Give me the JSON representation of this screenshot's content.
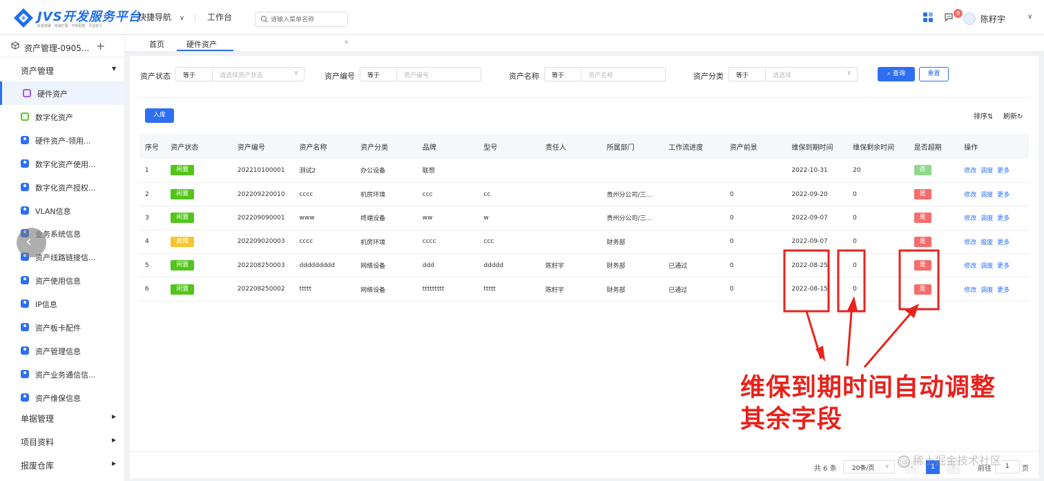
{
  "header": {
    "brand": "JVS开发服务平台",
    "slogan": "私有部署 · 快速扩展 · 可视配置 · 灵活定义",
    "quick_nav": "快捷导航",
    "workbench": "工作台",
    "search_placeholder": "请输入菜单名称",
    "msg_count": "9",
    "user_name": "陈籽宇"
  },
  "sidebar": {
    "project": "资产管理-0905...",
    "group_asset": "资产管理",
    "items": [
      {
        "label": "硬件资产",
        "color": "purple",
        "active": true
      },
      {
        "label": "数字化资产",
        "color": "green"
      },
      {
        "label": "硬件资产-领用...",
        "color": "blue"
      },
      {
        "label": "数字化资产使用...",
        "color": "blue"
      },
      {
        "label": "数字化资产授权...",
        "color": "blue"
      },
      {
        "label": "VLAN信息",
        "color": "blue"
      },
      {
        "label": "业务系统信息",
        "color": "blue"
      },
      {
        "label": "资产线路链接信...",
        "color": "blue"
      },
      {
        "label": "资产使用信息",
        "color": "blue"
      },
      {
        "label": "IP信息",
        "color": "blue"
      },
      {
        "label": "资产板卡配件",
        "color": "blue"
      },
      {
        "label": "资产管理信息",
        "color": "blue"
      },
      {
        "label": "资产业务通信信...",
        "color": "blue"
      },
      {
        "label": "资产维保信息",
        "color": "blue"
      }
    ],
    "groups": [
      "单据管理",
      "项目资料",
      "报废仓库"
    ]
  },
  "tabs": {
    "home": "首页",
    "current": "硬件资产"
  },
  "filters": {
    "status_label": "资产状态",
    "status_op": "等于",
    "status_placeholder": "请选择资产状态",
    "code_label": "资产编号",
    "code_op": "等于",
    "code_placeholder": "资产编号",
    "name_label": "资产名称",
    "name_op": "等于",
    "name_placeholder": "资产名称",
    "category_label": "资产分类",
    "category_op": "等于",
    "category_placeholder": "请选择",
    "query": "查询",
    "reset": "重置"
  },
  "toolbar": {
    "in": "入库",
    "sort": "排序⇅",
    "refresh": "刷新↻"
  },
  "table": {
    "headers": [
      "序号",
      "资产状态",
      "资产编号",
      "资产名称",
      "资产分类",
      "品牌",
      "型号",
      "责任人",
      "所属部门",
      "工作流进度",
      "资产前景",
      "维保到期时间",
      "维保剩余时间",
      "是否超期",
      "操作"
    ],
    "rows": [
      {
        "no": "1",
        "status": "闲置",
        "status_color": "green",
        "code": "202210100001",
        "name": "测试2",
        "category": "办公设备",
        "brand": "联想",
        "model": "",
        "owner": "",
        "dept": "",
        "flow": "",
        "prospect": "",
        "expire": "2022-10-31",
        "remain": "20",
        "overdue": "否",
        "overdue_color": "lightgreen",
        "ops": [
          "修改",
          "调度",
          "更多"
        ]
      },
      {
        "no": "2",
        "status": "闲置",
        "status_color": "green",
        "code": "202209220010",
        "name": "cccc",
        "category": "机房环境",
        "brand": "ccc",
        "model": "cc",
        "owner": "",
        "dept": "贵州分公司/三...",
        "flow": "",
        "prospect": "0",
        "expire": "2022-09-20",
        "remain": "0",
        "overdue": "是",
        "overdue_color": "red",
        "ops": [
          "修改",
          "调度",
          "更多"
        ]
      },
      {
        "no": "3",
        "status": "闲置",
        "status_color": "green",
        "code": "202209090001",
        "name": "www",
        "category": "终端设备",
        "brand": "ww",
        "model": "w",
        "owner": "",
        "dept": "贵州分公司/三...",
        "flow": "",
        "prospect": "0",
        "expire": "2022-09-07",
        "remain": "0",
        "overdue": "是",
        "overdue_color": "red",
        "ops": [
          "修改",
          "调度",
          "更多"
        ]
      },
      {
        "no": "4",
        "status": "故障",
        "status_color": "yellow",
        "code": "202209020003",
        "name": "cccc",
        "category": "机房环境",
        "brand": "cccc",
        "model": "ccc",
        "owner": "",
        "dept": "财务部",
        "flow": "",
        "prospect": "0",
        "expire": "2022-09-07",
        "remain": "0",
        "overdue": "是",
        "overdue_color": "red",
        "ops": [
          "修改",
          "报废",
          "更多"
        ]
      },
      {
        "no": "5",
        "status": "闲置",
        "status_color": "green",
        "code": "202208250003",
        "name": "ddddddddd",
        "category": "网络设备",
        "brand": "ddd",
        "model": "ddddd",
        "owner": "陈籽宇",
        "dept": "财务部",
        "flow": "已通过",
        "prospect": "0",
        "expire": "2022-08-25",
        "remain": "0",
        "overdue": "是",
        "overdue_color": "red",
        "ops": [
          "修改",
          "调度",
          "更多"
        ]
      },
      {
        "no": "6",
        "status": "闲置",
        "status_color": "green",
        "code": "202208250002",
        "name": "ttttt",
        "category": "网络设备",
        "brand": "ttttttttt",
        "model": "ttttt",
        "owner": "陈籽宇",
        "dept": "财务部",
        "flow": "已通过",
        "prospect": "0",
        "expire": "2022-08-15",
        "remain": "0",
        "overdue": "是",
        "overdue_color": "red",
        "ops": [
          "修改",
          "调度",
          "更多"
        ]
      }
    ]
  },
  "pager": {
    "total": "共 6 条",
    "size": "20条/页",
    "current": "1",
    "goto": "前往",
    "jump": "1",
    "page_word": "页"
  },
  "annotation": {
    "line1": "维保到期时间自动调整",
    "line2": "其余字段",
    "color": "#e8221c"
  },
  "watermark": "稀土掘金技术社区",
  "colors": {
    "primary": "#2e6ff2",
    "tag_green": "#52c41a",
    "tag_red": "#f56c6c",
    "tag_yellow": "#f7c431"
  }
}
